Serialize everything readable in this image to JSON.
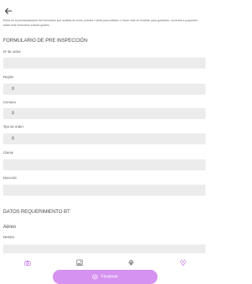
{
  "intro_text": "Estos es la previsualización del formulario que acabas de crear, puedes ir atrás para editarlo o hacer click en finalizar para guardarlo, recuerda a poquedes editar este formulario cuando gustes.",
  "sections": {
    "pre_inspection_title": "FORMULARIO DE PRE INSPECCIÓN",
    "requirement_title": "DATOS REQUERIMIENTO BT"
  },
  "fields": {
    "order_number": {
      "label": "Nº de orden",
      "value": ""
    },
    "region": {
      "label": "Región",
      "value": "0"
    },
    "commune": {
      "label": "Comuna",
      "value": "0"
    },
    "order_type": {
      "label": "Tipo de orden",
      "value": "0"
    },
    "client": {
      "label": "Cliente",
      "value": ""
    },
    "address": {
      "label": "Dirección",
      "value": ""
    },
    "aereo": {
      "label": "Aéreo"
    },
    "destination": {
      "label": "Destino",
      "value": ""
    }
  },
  "tabs": [
    {
      "icon": "camera-icon"
    },
    {
      "icon": "image-icon"
    },
    {
      "icon": "fingerprint-icon"
    },
    {
      "icon": "location-pin-icon"
    }
  ],
  "finalize_label": "Finalizar",
  "colors": {
    "accent": "#d592f0",
    "tab_icon": "#c782e6",
    "input_bg": "#ececec"
  }
}
